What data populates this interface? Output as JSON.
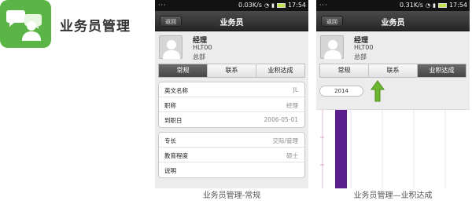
{
  "feature": {
    "title": "业务员管理"
  },
  "phone1": {
    "status": {
      "left": "···",
      "speed": "0.03K/s",
      "time": "17:54"
    },
    "nav": {
      "back": "返回",
      "title": "业务员"
    },
    "profile": {
      "name": "经理",
      "code": "HLT00",
      "dept": "总部"
    },
    "tabs": [
      "常规",
      "联系",
      "业积达成"
    ],
    "active_tab": 0,
    "card1": [
      {
        "label": "英文名称",
        "value": "JL"
      },
      {
        "label": "职称",
        "value": "经理"
      },
      {
        "label": "到职日",
        "value": "2006-05-01"
      }
    ],
    "card2": [
      {
        "label": "专长",
        "value": "交际/管理"
      },
      {
        "label": "教育程度",
        "value": "硕士"
      },
      {
        "label": "说明",
        "value": ""
      }
    ],
    "caption": "业务员管理-常规"
  },
  "phone2": {
    "status": {
      "left": "···",
      "speed": "0.31K/s",
      "time": "17:54"
    },
    "nav": {
      "back": "返回",
      "title": "业务员"
    },
    "profile": {
      "name": "经理",
      "code": "HLT00",
      "dept": "总部"
    },
    "tabs": [
      "常规",
      "联系",
      "业积达成"
    ],
    "active_tab": 2,
    "year": "2014",
    "caption": "业务员管理—业积达成"
  },
  "chart_data": {
    "type": "bar",
    "categories": [
      ""
    ],
    "values": [
      1
    ],
    "bar_color": "#5a1f8c"
  },
  "colors": {
    "brand_green": "#5bb446",
    "active_tab": "#4f4f4f",
    "arrow_green": "#6cb72e",
    "bar_purple": "#5a1f8c"
  }
}
